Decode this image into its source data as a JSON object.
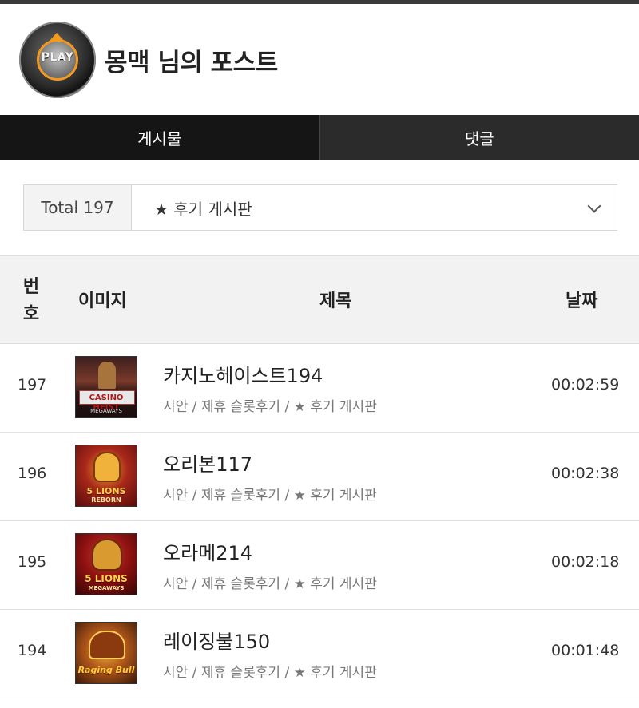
{
  "profile": {
    "title": "몽맥 님의 포스트",
    "avatar_text": "PLAY"
  },
  "tabs": [
    {
      "label": "게시물"
    },
    {
      "label": "댓글"
    }
  ],
  "filter": {
    "total": "Total 197",
    "selected": "★ 후기 게시판"
  },
  "table": {
    "headers": {
      "num": "번호",
      "image": "이미지",
      "title": "제목",
      "date": "날짜"
    },
    "rows": [
      {
        "num": "197",
        "title": "카지노헤이스트194",
        "meta": "시안 / 제휴 슬롯후기 / ★ 후기 게시판",
        "date": "00:02:59",
        "thumb_text": "CASINO HEIST",
        "thumb_sub": "MEGAWAYS"
      },
      {
        "num": "196",
        "title": "오리본117",
        "meta": "시안 / 제휴 슬롯후기 / ★ 후기 게시판",
        "date": "00:02:38",
        "thumb_text": "5 LIONS",
        "thumb_sub": "REBORN"
      },
      {
        "num": "195",
        "title": "오라메214",
        "meta": "시안 / 제휴 슬롯후기 / ★ 후기 게시판",
        "date": "00:02:18",
        "thumb_text": "5 LIONS",
        "thumb_sub": "MEGAWAYS"
      },
      {
        "num": "194",
        "title": "레이징불150",
        "meta": "시안 / 제휴 슬롯후기 / ★ 후기 게시판",
        "date": "00:01:48",
        "thumb_text": "Raging Bull"
      }
    ]
  }
}
